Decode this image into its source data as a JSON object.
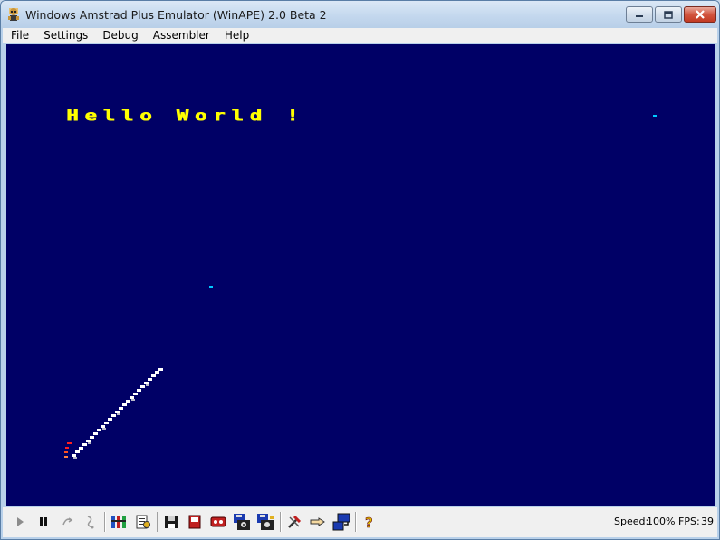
{
  "window": {
    "title": "Windows Amstrad Plus Emulator (WinAPE) 2.0 Beta 2"
  },
  "menu": {
    "items": [
      "File",
      "Settings",
      "Debug",
      "Assembler",
      "Help"
    ]
  },
  "screen": {
    "text": "Hello World !",
    "background_color": "#000066",
    "text_color": "#ffff00"
  },
  "toolbar": {
    "buttons": [
      {
        "name": "play-icon"
      },
      {
        "name": "pause-icon"
      },
      {
        "name": "step-icon"
      },
      {
        "name": "step-over-icon"
      },
      {
        "name": "rom-settings-icon"
      },
      {
        "name": "config-icon"
      },
      {
        "name": "disc-save-icon"
      },
      {
        "name": "snapshot-icon"
      },
      {
        "name": "tape-icon"
      },
      {
        "name": "disc-drive-a-icon"
      },
      {
        "name": "disc-drive-b-icon"
      },
      {
        "name": "tools-icon"
      },
      {
        "name": "pointer-icon"
      },
      {
        "name": "screen-transfer-icon"
      },
      {
        "name": "help-icon"
      }
    ]
  },
  "status": {
    "speed_label": "Speed:",
    "speed_value": "100%",
    "fps_label": "FPS:",
    "fps_value": "39"
  }
}
